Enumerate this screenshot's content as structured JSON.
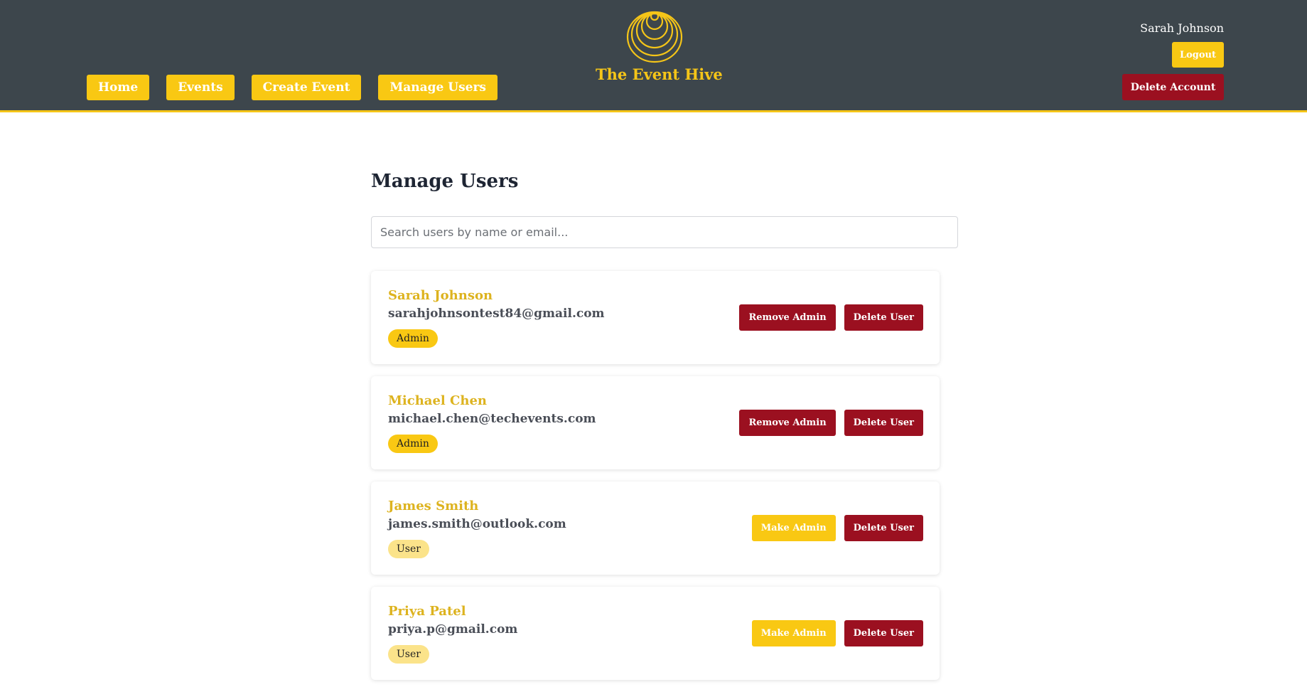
{
  "app": {
    "brand": "The Event Hive"
  },
  "nav": {
    "items": [
      {
        "label": "Home"
      },
      {
        "label": "Events"
      },
      {
        "label": "Create Event"
      },
      {
        "label": "Manage Users"
      }
    ]
  },
  "account": {
    "user_name": "Sarah Johnson",
    "logout_label": "Logout",
    "delete_account_label": "Delete Account"
  },
  "page": {
    "title": "Manage Users",
    "search_placeholder": "Search users by name or email..."
  },
  "users": [
    {
      "name": "Sarah Johnson",
      "email": "sarahjohnsontest84@gmail.com",
      "role": "Admin",
      "toggle_label": "Remove Admin",
      "delete_label": "Delete User"
    },
    {
      "name": "Michael Chen",
      "email": "michael.chen@techevents.com",
      "role": "Admin",
      "toggle_label": "Remove Admin",
      "delete_label": "Delete User"
    },
    {
      "name": "James Smith",
      "email": "james.smith@outlook.com",
      "role": "User",
      "toggle_label": "Make Admin",
      "delete_label": "Delete User"
    },
    {
      "name": "Priya Patel",
      "email": "priya.p@gmail.com",
      "role": "User",
      "toggle_label": "Make Admin",
      "delete_label": "Delete User"
    }
  ],
  "colors": {
    "header_bg": "#3d464c",
    "accent_yellow": "#f9c813",
    "danger_red": "#9b1020"
  },
  "icons": {
    "logo": "beehive-icon"
  }
}
